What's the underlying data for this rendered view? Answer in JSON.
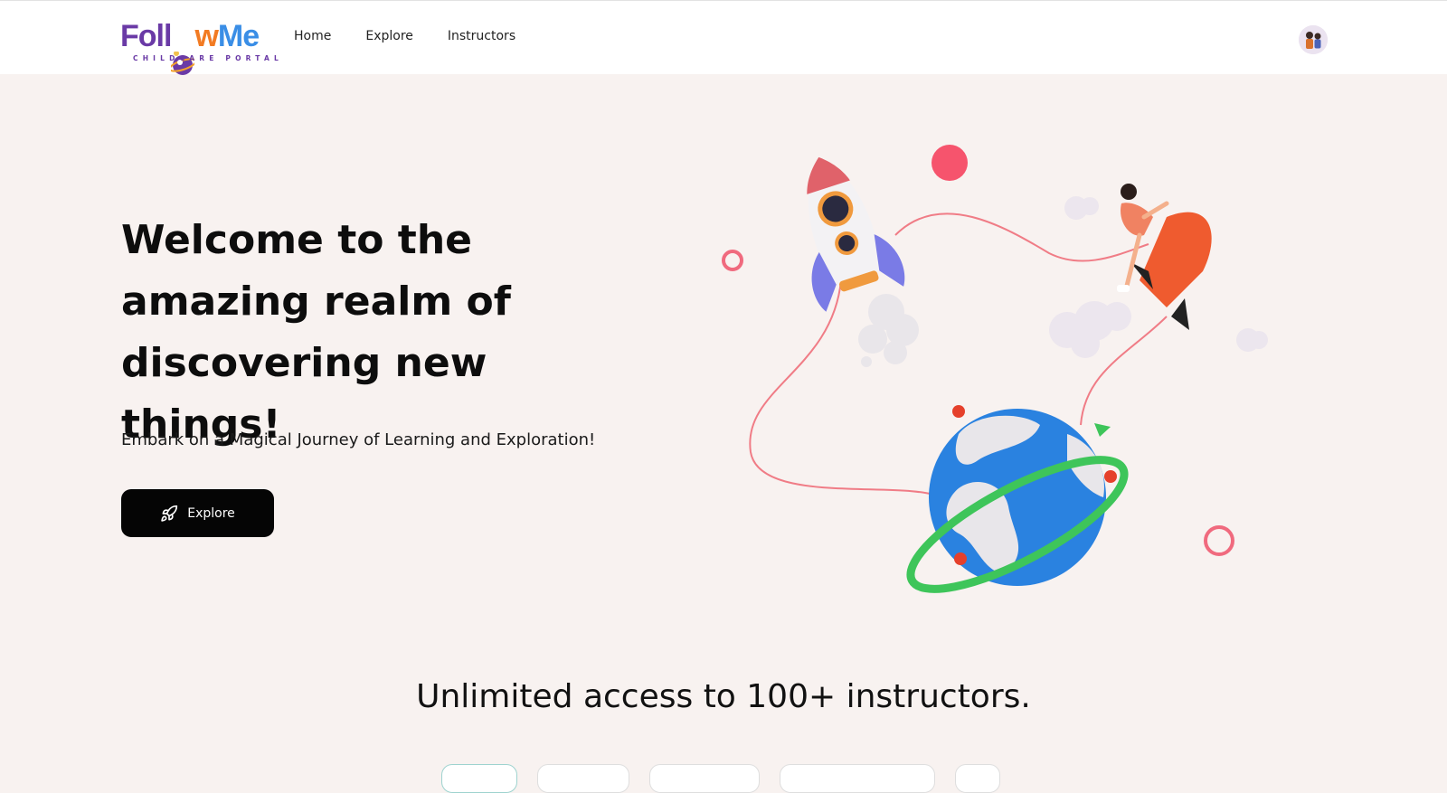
{
  "brand": {
    "logo_text_parts": [
      "Foll",
      "o",
      "w",
      "Me"
    ],
    "tagline": "CHILDCARE PORTAL",
    "colors": {
      "purple": "#6a3aa6",
      "green": "#7ac142",
      "orange": "#f27b23",
      "blue": "#3a8ee6"
    }
  },
  "nav": {
    "items": [
      {
        "label": "Home"
      },
      {
        "label": "Explore"
      },
      {
        "label": "Instructors"
      }
    ],
    "avatar_icon": "user-avatar-icon"
  },
  "hero": {
    "title": "Welcome to the amazing realm of discovering new things!",
    "subtitle": "Embark on a Magical Journey of Learning and Exploration!",
    "cta": {
      "label": "Explore",
      "icon": "rocket-icon"
    }
  },
  "instructors_section": {
    "heading": "Unlimited access to 100+ instructors."
  },
  "theme": {
    "page_bg": "#f8f2f0",
    "button_bg": "#050505",
    "button_text": "#ffffff"
  }
}
